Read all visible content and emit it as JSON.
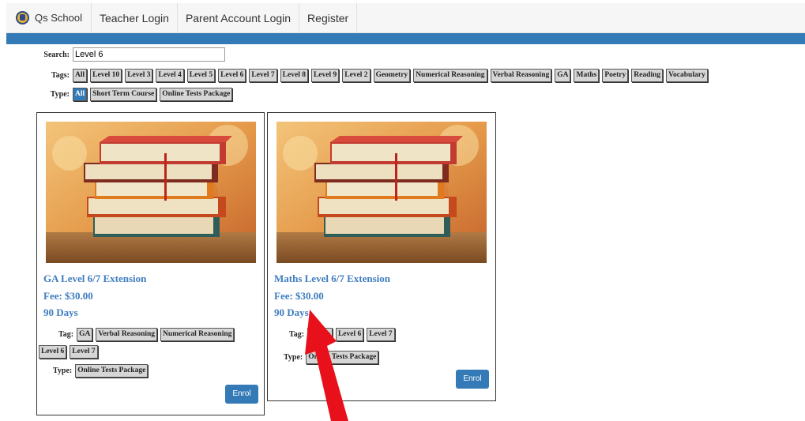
{
  "nav": {
    "brand": "Qs School",
    "links": [
      "Teacher Login",
      "Parent Account Login",
      "Register"
    ]
  },
  "filters": {
    "search_label": "Search:",
    "search_value": "Level 6",
    "tags_label": "Tags:",
    "tags": [
      "All",
      "Level 10",
      "Level 3",
      "Level 4",
      "Level 5",
      "Level 6",
      "Level 7",
      "Level 8",
      "Level 9",
      "Level 2",
      "Geometry",
      "Numerical Reasoning",
      "Verbal Reasoning",
      "GA",
      "Maths",
      "Poetry",
      "Reading",
      "Vocabulary"
    ],
    "type_label": "Type:",
    "types": [
      "All",
      "Short Term Course",
      "Online Tests Package"
    ]
  },
  "cards": [
    {
      "title": "GA Level 6/7 Extension",
      "fee": "Fee: $30.00",
      "duration": "90 Days",
      "tag_label": "Tag:",
      "tags": [
        "GA",
        "Verbal Reasoning",
        "Numerical Reasoning",
        "Level 6",
        "Level 7"
      ],
      "type_label": "Type:",
      "type": "Online Tests Package",
      "enrol": "Enrol"
    },
    {
      "title": "Maths Level 6/7 Extension",
      "fee": "Fee: $30.00",
      "duration": "90 Days",
      "tag_label": "Tag:",
      "tags": [
        "Maths",
        "Level 6",
        "Level 7"
      ],
      "type_label": "Type:",
      "type": "Online Tests Package",
      "enrol": "Enrol"
    }
  ],
  "colors": {
    "accent": "#337ab7",
    "title_blue": "#3f7dbf",
    "annotation_arrow": "#e8111b"
  }
}
